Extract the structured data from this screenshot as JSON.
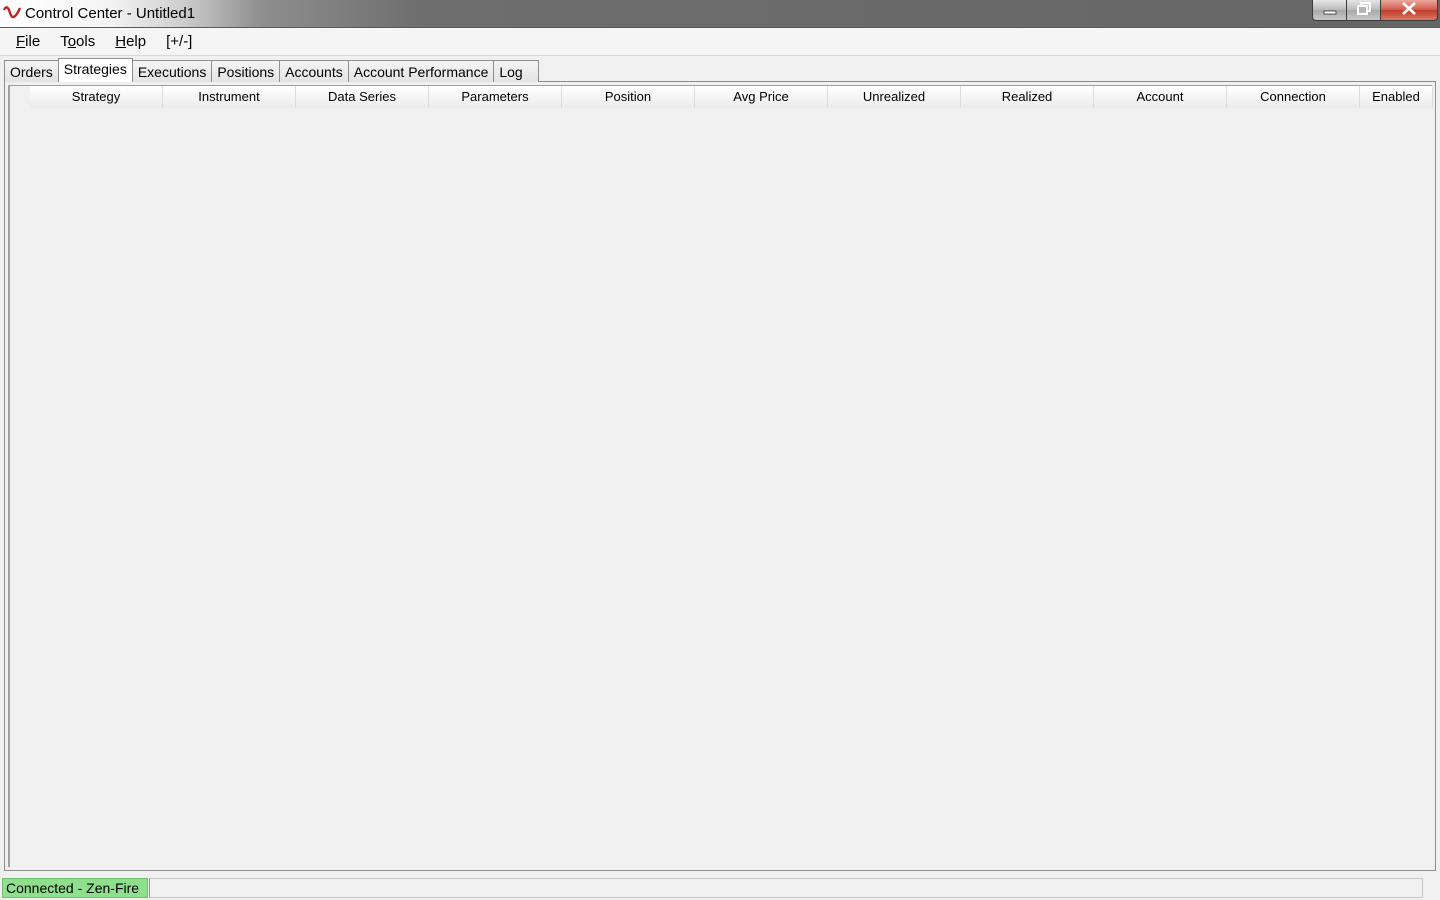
{
  "window": {
    "title": "Control Center - Untitled1",
    "app_icon": "ninja-swoosh-icon"
  },
  "title_buttons": {
    "minimize_icon": "minimize-icon",
    "maximize_icon": "restore-icon",
    "close_icon": "close-icon"
  },
  "menu": {
    "items": [
      {
        "label_pre": "",
        "label_u": "F",
        "label_post": "ile"
      },
      {
        "label_pre": "T",
        "label_u": "o",
        "label_post": "ols"
      },
      {
        "label_pre": "",
        "label_u": "H",
        "label_post": "elp"
      },
      {
        "label_pre": "[+/-]",
        "label_u": "",
        "label_post": ""
      }
    ]
  },
  "tabs": {
    "items": [
      {
        "label": "Orders"
      },
      {
        "label": "Strategies"
      },
      {
        "label": "Executions"
      },
      {
        "label": "Positions"
      },
      {
        "label": "Accounts"
      },
      {
        "label": "Account Performance"
      },
      {
        "label": "Log"
      }
    ],
    "active": "Strategies"
  },
  "grid": {
    "columns": [
      {
        "label": "Strategy"
      },
      {
        "label": "Instrument"
      },
      {
        "label": "Data Series"
      },
      {
        "label": "Parameters"
      },
      {
        "label": "Position"
      },
      {
        "label": "Avg Price"
      },
      {
        "label": "Unrealized"
      },
      {
        "label": "Realized"
      },
      {
        "label": "Account"
      },
      {
        "label": "Connection"
      },
      {
        "label": "Enabled"
      }
    ],
    "rows": []
  },
  "status": {
    "connection": "Connected - Zen-Fire",
    "connection_color": "#8ee08c"
  }
}
